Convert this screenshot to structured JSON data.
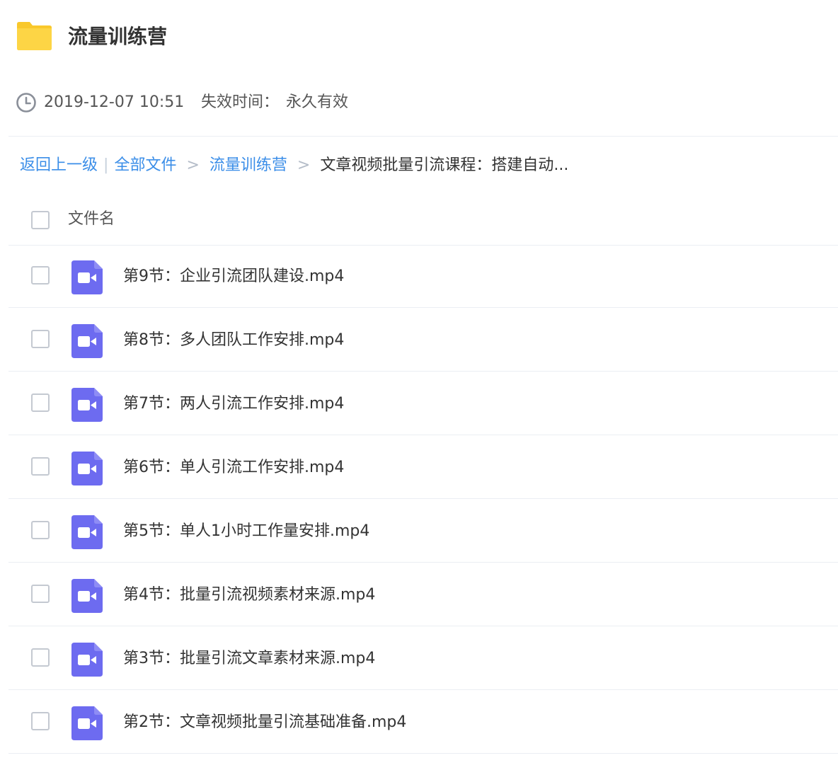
{
  "folder": {
    "icon": "folder-icon",
    "icon_color": "#f9c82b",
    "title": "流量训练营"
  },
  "meta": {
    "icon": "clock-icon",
    "date": "2019-12-07 10:51",
    "expire_label": "失效时间：",
    "expire_value": "永久有效"
  },
  "breadcrumb": {
    "back": "返回上一级",
    "bar": "|",
    "all_files": "全部文件",
    "arrow": ">",
    "parent": "流量训练营",
    "current": "文章视频批量引流课程：搭建自动..."
  },
  "list": {
    "header_label": "文件名",
    "file_icon": "video-icon",
    "file_icon_color": "#6d6bf0",
    "link_color": "#3b8ee8",
    "files": [
      {
        "name": "第9节：企业引流团队建设.mp4"
      },
      {
        "name": "第8节：多人团队工作安排.mp4"
      },
      {
        "name": "第7节：两人引流工作安排.mp4"
      },
      {
        "name": "第6节：单人引流工作安排.mp4"
      },
      {
        "name": "第5节：单人1小时工作量安排.mp4"
      },
      {
        "name": "第4节：批量引流视频素材来源.mp4"
      },
      {
        "name": "第3节：批量引流文章素材来源.mp4"
      },
      {
        "name": "第2节：文章视频批量引流基础准备.mp4"
      }
    ]
  }
}
